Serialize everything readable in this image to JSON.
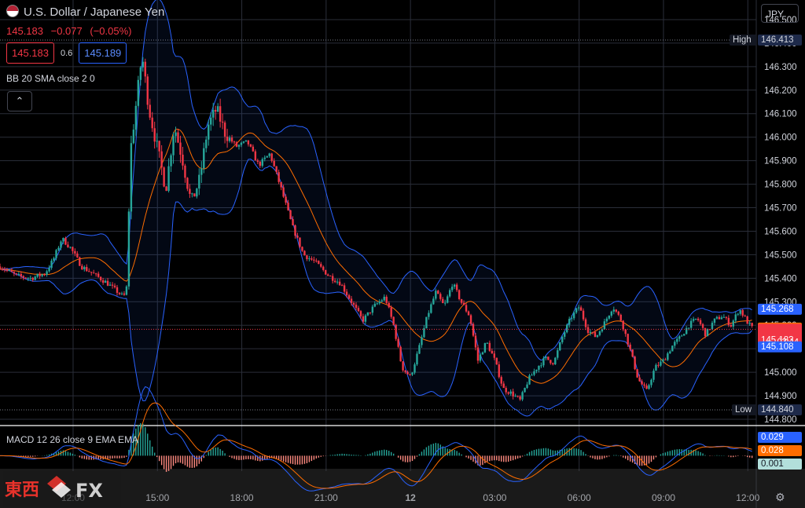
{
  "header": {
    "title": "U.S. Dollar / Japanese Yen",
    "last": "145.183",
    "change": "−0.077",
    "change_pct": "(−0.05%)",
    "sell": "145.183",
    "spread": "0.6",
    "buy": "145.189",
    "currency": "JPY"
  },
  "indicators": {
    "bb_label": "BB 20 SMA close 2 0",
    "macd_label": "MACD 12 26 close 9 EMA EMA"
  },
  "watermark": {
    "text_cn": "東西",
    "text_fx": "FX"
  },
  "colors": {
    "up": "#26a69a",
    "down": "#f23645",
    "bb": "#2962ff",
    "sma": "#ff6d00",
    "grid": "#2a2e39"
  },
  "chart_data": {
    "type": "candlestick",
    "ylim": [
      144.78,
      146.55
    ],
    "yticks": [
      "146.500",
      "146.400",
      "146.300",
      "146.200",
      "146.100",
      "146.000",
      "145.900",
      "145.800",
      "145.700",
      "145.600",
      "145.500",
      "145.400",
      "145.300",
      "145.200",
      "145.100",
      "145.000",
      "144.900",
      "144.800"
    ],
    "xticks": [
      "12:00",
      "15:00",
      "18:00",
      "21:00",
      "12",
      "03:00",
      "06:00",
      "09:00",
      "12:00"
    ],
    "xtick_hours": [
      12,
      15,
      18,
      21,
      24,
      27,
      30,
      33,
      36
    ],
    "xlim_hours": [
      9.4,
      36.3
    ],
    "high": {
      "label": "High",
      "value": 146.413,
      "text": "146.413"
    },
    "low": {
      "label": "Low",
      "value": 144.84,
      "text": "144.840"
    },
    "current_price": {
      "value": 145.183,
      "text": "145.183",
      "countdown": "02:44"
    },
    "bb_upper_last": {
      "value": 145.268,
      "text": "145.268"
    },
    "bb_basis_last": {
      "value": 145.188,
      "text": "145.188"
    },
    "bb_lower_last": {
      "value": 145.108,
      "text": "145.108"
    },
    "close_path": [
      [
        9.4,
        145.45
      ],
      [
        10.0,
        145.41
      ],
      [
        10.5,
        145.4
      ],
      [
        11.0,
        145.42
      ],
      [
        11.3,
        145.48
      ],
      [
        11.6,
        145.57
      ],
      [
        11.9,
        145.53
      ],
      [
        12.3,
        145.45
      ],
      [
        12.7,
        145.42
      ],
      [
        13.2,
        145.38
      ],
      [
        13.8,
        145.32
      ],
      [
        13.9,
        145.36
      ],
      [
        14.05,
        145.95
      ],
      [
        14.2,
        146.1
      ],
      [
        14.45,
        146.35
      ],
      [
        14.7,
        146.12
      ],
      [
        15.0,
        145.95
      ],
      [
        15.3,
        145.78
      ],
      [
        15.6,
        146.05
      ],
      [
        15.9,
        145.9
      ],
      [
        16.2,
        145.72
      ],
      [
        16.5,
        145.82
      ],
      [
        16.8,
        146.05
      ],
      [
        17.1,
        146.12
      ],
      [
        17.4,
        146.02
      ],
      [
        17.8,
        145.96
      ],
      [
        18.2,
        145.98
      ],
      [
        18.6,
        145.88
      ],
      [
        19.0,
        145.93
      ],
      [
        19.4,
        145.78
      ],
      [
        19.8,
        145.62
      ],
      [
        20.2,
        145.5
      ],
      [
        20.6,
        145.47
      ],
      [
        21.1,
        145.41
      ],
      [
        21.5,
        145.38
      ],
      [
        21.9,
        145.3
      ],
      [
        22.3,
        145.22
      ],
      [
        22.7,
        145.28
      ],
      [
        23.1,
        145.32
      ],
      [
        23.4,
        145.2
      ],
      [
        23.7,
        145.02
      ],
      [
        24.0,
        144.98
      ],
      [
        24.3,
        145.1
      ],
      [
        24.6,
        145.24
      ],
      [
        24.9,
        145.34
      ],
      [
        25.2,
        145.28
      ],
      [
        25.5,
        145.38
      ],
      [
        25.8,
        145.3
      ],
      [
        26.1,
        145.24
      ],
      [
        26.4,
        145.05
      ],
      [
        26.7,
        145.13
      ],
      [
        27.0,
        145.05
      ],
      [
        27.3,
        144.93
      ],
      [
        27.6,
        144.91
      ],
      [
        27.9,
        144.88
      ],
      [
        28.2,
        144.97
      ],
      [
        28.5,
        145.02
      ],
      [
        28.8,
        145.06
      ],
      [
        29.1,
        145.04
      ],
      [
        29.4,
        145.15
      ],
      [
        29.7,
        145.23
      ],
      [
        30.0,
        145.28
      ],
      [
        30.3,
        145.18
      ],
      [
        30.6,
        145.15
      ],
      [
        30.9,
        145.21
      ],
      [
        31.2,
        145.28
      ],
      [
        31.5,
        145.22
      ],
      [
        31.8,
        145.1
      ],
      [
        32.1,
        144.97
      ],
      [
        32.4,
        144.92
      ],
      [
        32.7,
        145.02
      ],
      [
        33.0,
        145.05
      ],
      [
        33.3,
        145.11
      ],
      [
        33.6,
        145.15
      ],
      [
        33.9,
        145.2
      ],
      [
        34.2,
        145.23
      ],
      [
        34.5,
        145.16
      ],
      [
        34.8,
        145.22
      ],
      [
        35.1,
        145.24
      ],
      [
        35.4,
        145.2
      ],
      [
        35.7,
        145.27
      ],
      [
        36.0,
        145.21
      ],
      [
        36.2,
        145.183
      ]
    ],
    "macd": {
      "ylim": [
        -0.05,
        0.07
      ],
      "macd_last": {
        "value": 0.029,
        "text": "0.029"
      },
      "signal_last": {
        "value": 0.028,
        "text": "0.028"
      },
      "hist_last": {
        "value": 0.001,
        "text": "0.001"
      }
    }
  }
}
